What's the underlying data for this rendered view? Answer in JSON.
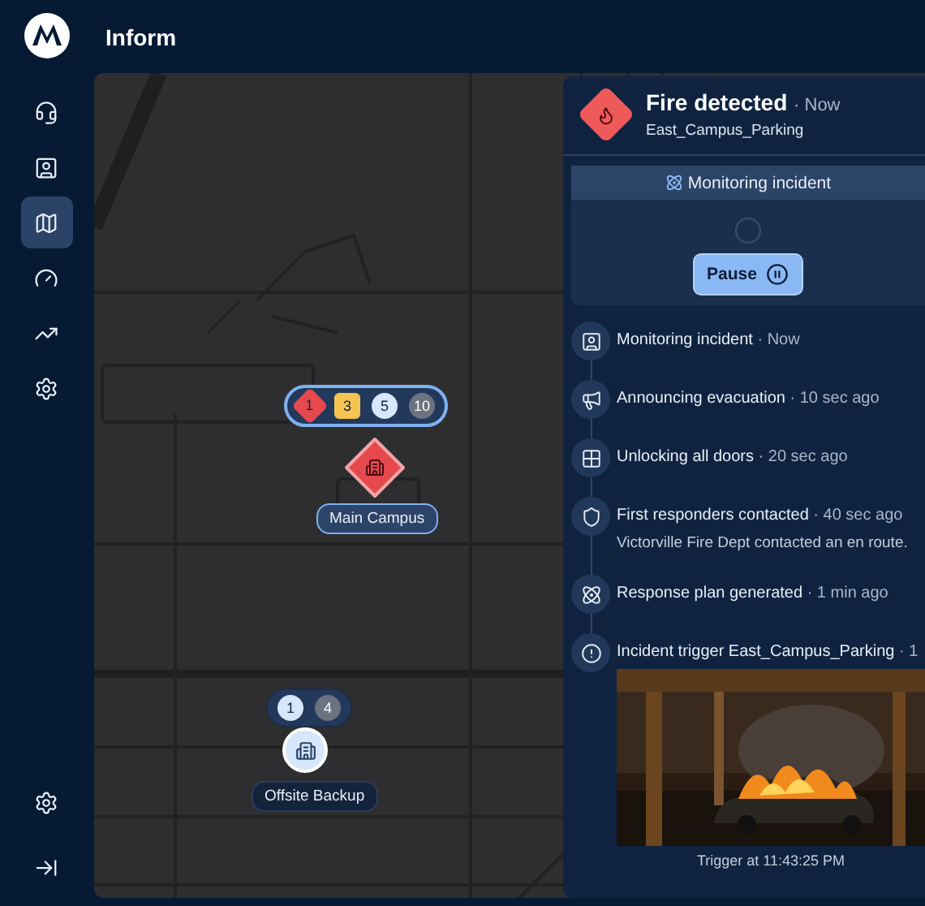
{
  "app": {
    "title": "Inform"
  },
  "sidebar": {
    "items": [
      {
        "kind": "headset",
        "selected": false
      },
      {
        "kind": "screen",
        "selected": false
      },
      {
        "kind": "map",
        "selected": true
      },
      {
        "kind": "gauge",
        "selected": false
      },
      {
        "kind": "trend",
        "selected": false
      },
      {
        "kind": "settings",
        "selected": false
      }
    ],
    "footer": [
      {
        "kind": "settings"
      },
      {
        "kind": "collapse"
      }
    ]
  },
  "map": {
    "sites": [
      {
        "name": "Main Campus",
        "kind": "alert",
        "counts": [
          {
            "value": "1",
            "kind": "diamond",
            "color": "#e5484d"
          },
          {
            "value": "3",
            "kind": "square",
            "color": "#f5c451"
          },
          {
            "value": "5",
            "kind": "circle",
            "color": "#d6e6fb"
          },
          {
            "value": "10",
            "kind": "circle",
            "color": "#6b7280"
          }
        ]
      },
      {
        "name": "Offsite Backup",
        "kind": "normal",
        "counts": [
          {
            "value": "1",
            "kind": "circle",
            "color": "#d6e6fb"
          },
          {
            "value": "4",
            "kind": "circle",
            "color": "#6b7280"
          }
        ]
      }
    ]
  },
  "panel": {
    "title": "Fire detected",
    "time": "· Now",
    "location": "East_Campus_Parking",
    "status": {
      "label": "Monitoring incident",
      "button": "Pause"
    },
    "timeline": [
      {
        "kind": "monitoring",
        "title": "Monitoring incident",
        "time": "· Now"
      },
      {
        "kind": "announcement",
        "title": "Announcing evacuation",
        "time": "· 10 sec ago"
      },
      {
        "kind": "doors",
        "title": "Unlocking all doors",
        "time": "· 20 sec ago"
      },
      {
        "kind": "responders",
        "title": "First responders contacted",
        "time": "· 40 sec ago",
        "detail": "Victorville Fire Dept contacted an en route."
      },
      {
        "kind": "plan",
        "title": "Response plan generated",
        "time": "· 1 min ago"
      },
      {
        "kind": "trigger",
        "title": "Incident trigger East_Campus_Parking",
        "time": "· 1",
        "caption": "Trigger at 11:43:25 PM"
      }
    ]
  }
}
